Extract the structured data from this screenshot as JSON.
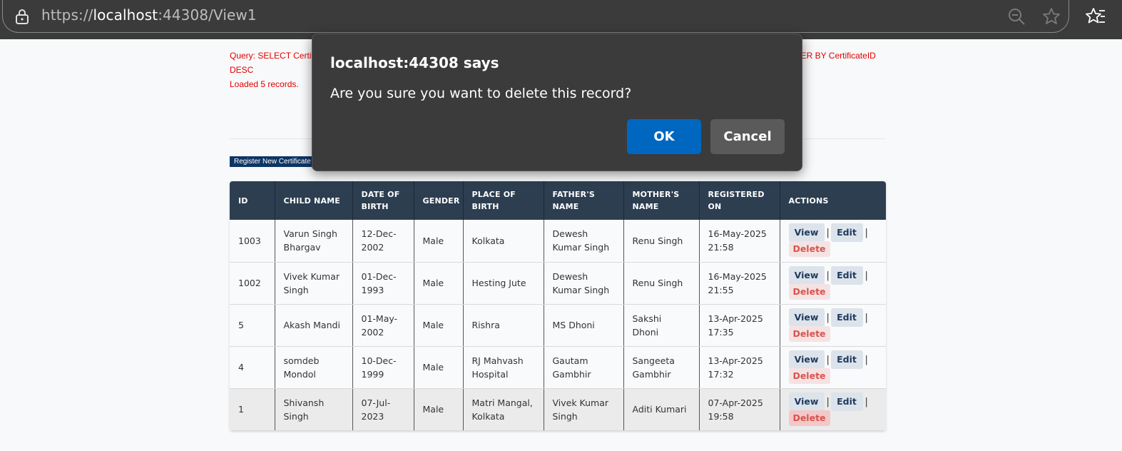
{
  "browser": {
    "url_scheme": "https://",
    "url_host": "localhost",
    "url_rest": ":44308/View1"
  },
  "page": {
    "query_left": "Query: SELECT Certific",
    "query_right": "DER BY CertificateID",
    "query_desc": "DESC",
    "loaded": "Loaded 5 records.",
    "register_button": "Register New Certificate"
  },
  "table": {
    "headers": [
      "ID",
      "CHILD NAME",
      "DATE OF BIRTH",
      "GENDER",
      "PLACE OF BIRTH",
      "FATHER'S NAME",
      "MOTHER'S NAME",
      "REGISTERED ON",
      "ACTIONS"
    ],
    "action_labels": {
      "view": "View",
      "edit": "Edit",
      "delete": "Delete",
      "sep": "|"
    },
    "rows": [
      {
        "id": "1003",
        "child": "Varun Singh Bhargav",
        "dob": "12-Dec-2002",
        "gender": "Male",
        "place": "Kolkata",
        "father": "Dewesh Kumar Singh",
        "mother": "Renu Singh",
        "registered": "16-May-2025 21:58"
      },
      {
        "id": "1002",
        "child": "Vivek Kumar Singh",
        "dob": "01-Dec-1993",
        "gender": "Male",
        "place": "Hesting Jute",
        "father": "Dewesh Kumar Singh",
        "mother": "Renu Singh",
        "registered": "16-May-2025 21:55"
      },
      {
        "id": "5",
        "child": "Akash Mandi",
        "dob": "01-May-2002",
        "gender": "Male",
        "place": "Rishra",
        "father": "MS Dhoni",
        "mother": "Sakshi Dhoni",
        "registered": "13-Apr-2025 17:35"
      },
      {
        "id": "4",
        "child": "somdeb Mondol",
        "dob": "10-Dec-1999",
        "gender": "Male",
        "place": "RJ Mahvash Hospital",
        "father": "Gautam Gambhir",
        "mother": "Sangeeta Gambhir",
        "registered": "13-Apr-2025 17:32"
      },
      {
        "id": "1",
        "child": "Shivansh Singh",
        "dob": "07-Jul-2023",
        "gender": "Male",
        "place": "Matri Mangal, Kolkata",
        "father": "Vivek Kumar Singh",
        "mother": "Aditi Kumari",
        "registered": "07-Apr-2025 19:58"
      }
    ]
  },
  "dialog": {
    "title": "localhost:44308 says",
    "message": "Are you sure you want to delete this record?",
    "ok": "OK",
    "cancel": "Cancel"
  }
}
